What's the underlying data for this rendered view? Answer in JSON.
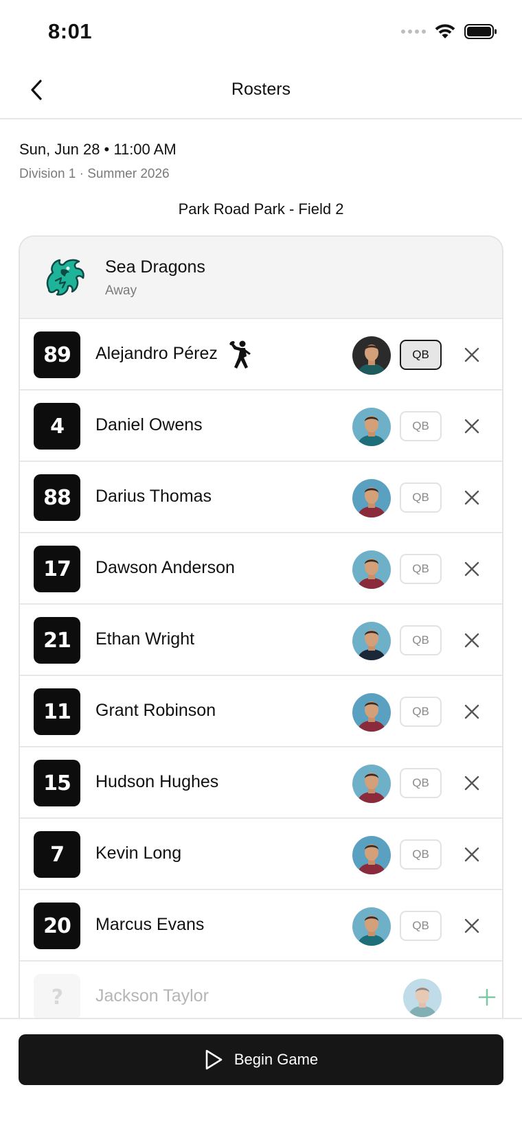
{
  "status_bar": {
    "time": "8:01"
  },
  "nav": {
    "title": "Rosters"
  },
  "game": {
    "date": "Sun, Jun 28 • 11:00 AM",
    "division": "Division 1 · Summer 2026",
    "location": "Park Road Park - Field 2"
  },
  "team": {
    "name": "Sea Dragons",
    "side": "Away",
    "colors": {
      "logo_primary": "#1fb39a",
      "logo_dark": "#0d4a44"
    }
  },
  "players": [
    {
      "number": "89",
      "name": "Alejandro Pérez",
      "qb_label": "QB",
      "qb_active": true,
      "has_qb_icon": true,
      "avatar_bg": "#2b2b2b",
      "jersey": "#1d5b5c"
    },
    {
      "number": "4",
      "name": "Daniel Owens",
      "qb_label": "QB",
      "qb_active": false,
      "avatar_bg": "#6fb0c9",
      "jersey": "#1d6e78"
    },
    {
      "number": "88",
      "name": "Darius Thomas",
      "qb_label": "QB",
      "qb_active": false,
      "avatar_bg": "#5aa0c0",
      "jersey": "#8a2a3a"
    },
    {
      "number": "17",
      "name": "Dawson Anderson",
      "qb_label": "QB",
      "qb_active": false,
      "avatar_bg": "#6fb0c9",
      "jersey": "#8a2a3a"
    },
    {
      "number": "21",
      "name": "Ethan Wright",
      "qb_label": "QB",
      "qb_active": false,
      "avatar_bg": "#6fb0c9",
      "jersey": "#1b2838"
    },
    {
      "number": "11",
      "name": "Grant Robinson",
      "qb_label": "QB",
      "qb_active": false,
      "avatar_bg": "#5aa0c0",
      "jersey": "#8a2a3a"
    },
    {
      "number": "15",
      "name": "Hudson Hughes",
      "qb_label": "QB",
      "qb_active": false,
      "avatar_bg": "#6fb0c9",
      "jersey": "#8a2a3a"
    },
    {
      "number": "7",
      "name": "Kevin Long",
      "qb_label": "QB",
      "qb_active": false,
      "avatar_bg": "#5aa0c0",
      "jersey": "#8a2a3a"
    },
    {
      "number": "20",
      "name": "Marcus Evans",
      "qb_label": "QB",
      "qb_active": false,
      "avatar_bg": "#6fb0c9",
      "jersey": "#1d6e78"
    }
  ],
  "inactive_player": {
    "number": "?",
    "name": "Jackson Taylor",
    "avatar_bg": "#8cc1d6",
    "jersey": "#1d6e78"
  },
  "footer": {
    "begin_label": "Begin Game"
  },
  "icons": {
    "back": "chevron-left-icon",
    "remove": "close-icon",
    "add": "plus-icon",
    "begin": "play-icon",
    "qb": "quarterback-icon",
    "wifi": "wifi-icon",
    "battery": "battery-icon",
    "signal": "signal-icon"
  },
  "accent": {
    "add_green": "#7fc8a4"
  }
}
